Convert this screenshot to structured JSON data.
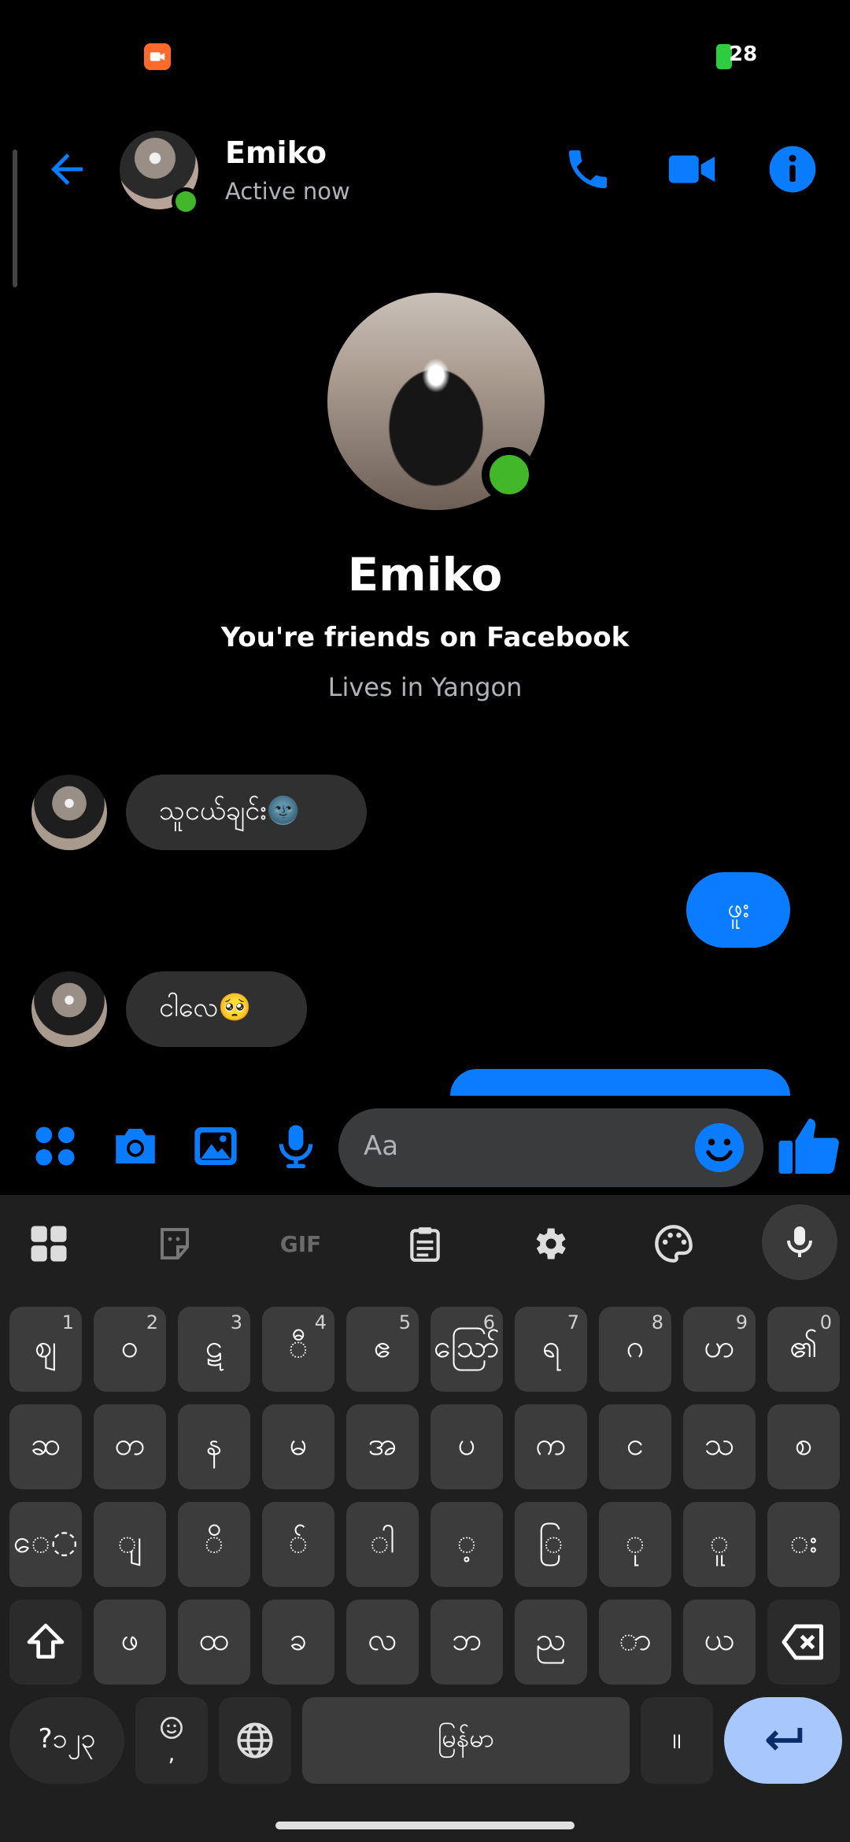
{
  "status_bar": {
    "battery_text": "28"
  },
  "header": {
    "contact_name": "Emiko",
    "contact_status": "Active now"
  },
  "profile": {
    "name": "Emiko",
    "friends_line": "You're friends on Facebook",
    "lives_line": "Lives in Yangon"
  },
  "messages": [
    {
      "direction": "in",
      "text": "သူငယ်ချင်း🌚"
    },
    {
      "direction": "out",
      "text": "ဖူး"
    },
    {
      "direction": "in",
      "text": "ငါလေ🥺"
    }
  ],
  "composer": {
    "placeholder": "Aa"
  },
  "keyboard": {
    "toolbar": [
      "apps-icon",
      "sticker-icon",
      "gif-icon",
      "clipboard-icon",
      "settings-icon",
      "palette-icon",
      "mic-icon"
    ],
    "gif_label": "GIF",
    "row1": [
      {
        "k": "ဈ",
        "n": "1"
      },
      {
        "k": "ဝ",
        "n": "2"
      },
      {
        "k": "ဋ",
        "n": "3"
      },
      {
        "k": "◌ီ",
        "n": "4"
      },
      {
        "k": "ဧ",
        "n": "5"
      },
      {
        "k": "ဪ",
        "n": "6"
      },
      {
        "k": "ရ",
        "n": "7"
      },
      {
        "k": "ဂ",
        "n": "8"
      },
      {
        "k": "ဟ",
        "n": "9"
      },
      {
        "k": "၏",
        "n": "0"
      }
    ],
    "row2": [
      "ဆ",
      "တ",
      "န",
      "မ",
      "အ",
      "ပ",
      "က",
      "င",
      "သ",
      "စ"
    ],
    "row3": [
      "ေ◌",
      "◌ျ",
      "◌ိ",
      "◌်",
      "◌ါ",
      "◌့",
      "◌ြ",
      "◌ု",
      "◌ူ",
      "◌း"
    ],
    "row4": [
      "ဖ",
      "ထ",
      "ခ",
      "လ",
      "ဘ",
      "ည",
      "◌ာ",
      "ယ"
    ],
    "symbols_label": "?၁၂၃",
    "emoji_comma": ",",
    "space_label": "မြန်မာ",
    "period_label": "။"
  }
}
